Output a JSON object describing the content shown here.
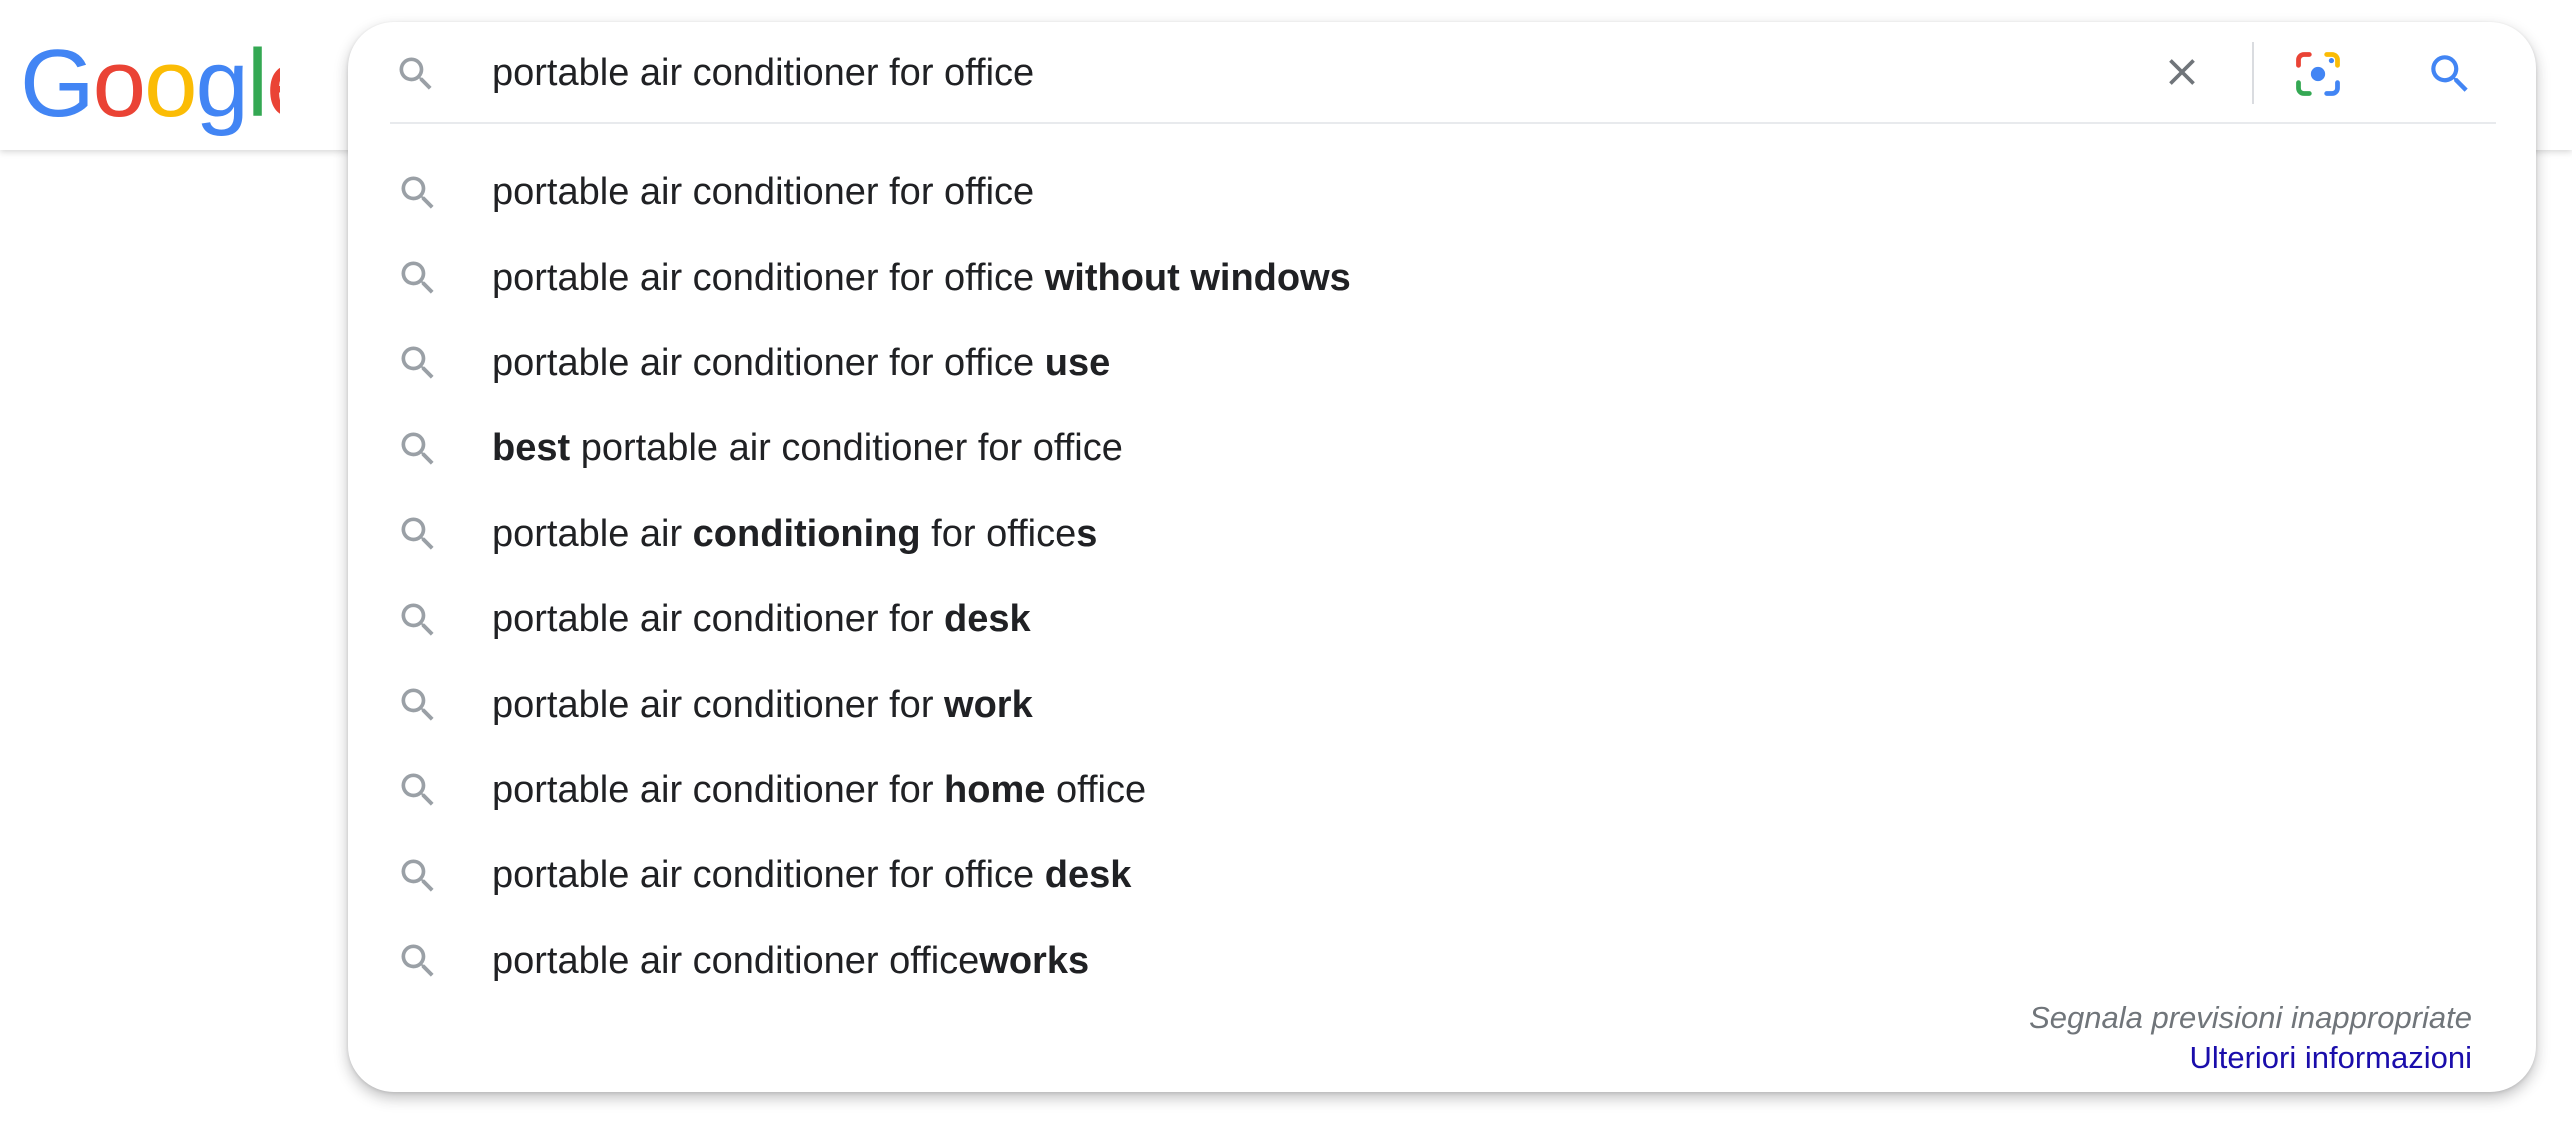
{
  "logo": {
    "letters": [
      "G",
      "o",
      "o",
      "g",
      "l",
      "e"
    ],
    "colors": [
      "#4285F4",
      "#EA4335",
      "#FBBC05",
      "#4285F4",
      "#34A853",
      "#EA4335"
    ]
  },
  "search": {
    "value": "portable air conditioner for office",
    "clear_icon": "close-icon",
    "lens_icon": "google-lens-icon",
    "submit_icon": "search-icon",
    "accent_color": "#4285F4"
  },
  "suggestions": [
    {
      "segments": [
        {
          "text": "portable air conditioner for office",
          "bold": false
        }
      ]
    },
    {
      "segments": [
        {
          "text": "portable air conditioner for office ",
          "bold": false
        },
        {
          "text": "without windows",
          "bold": true
        }
      ]
    },
    {
      "segments": [
        {
          "text": "portable air conditioner for office ",
          "bold": false
        },
        {
          "text": "use",
          "bold": true
        }
      ]
    },
    {
      "segments": [
        {
          "text": "best",
          "bold": true
        },
        {
          "text": " portable air conditioner for office",
          "bold": false
        }
      ]
    },
    {
      "segments": [
        {
          "text": "portable air ",
          "bold": false
        },
        {
          "text": "conditioning",
          "bold": true
        },
        {
          "text": " for office",
          "bold": false
        },
        {
          "text": "s",
          "bold": true
        }
      ]
    },
    {
      "segments": [
        {
          "text": "portable air conditioner for ",
          "bold": false
        },
        {
          "text": "desk",
          "bold": true
        }
      ]
    },
    {
      "segments": [
        {
          "text": "portable air conditioner for ",
          "bold": false
        },
        {
          "text": "work",
          "bold": true
        }
      ]
    },
    {
      "segments": [
        {
          "text": "portable air conditioner for ",
          "bold": false
        },
        {
          "text": "home",
          "bold": true
        },
        {
          "text": " office",
          "bold": false
        }
      ]
    },
    {
      "segments": [
        {
          "text": "portable air conditioner for office ",
          "bold": false
        },
        {
          "text": "desk",
          "bold": true
        }
      ]
    },
    {
      "segments": [
        {
          "text": "portable air conditioner office",
          "bold": false
        },
        {
          "text": "works",
          "bold": true
        }
      ]
    }
  ],
  "footer": {
    "report_label": "Segnala previsioni inappropriate",
    "learn_more_label": "Ulteriori informazioni"
  }
}
